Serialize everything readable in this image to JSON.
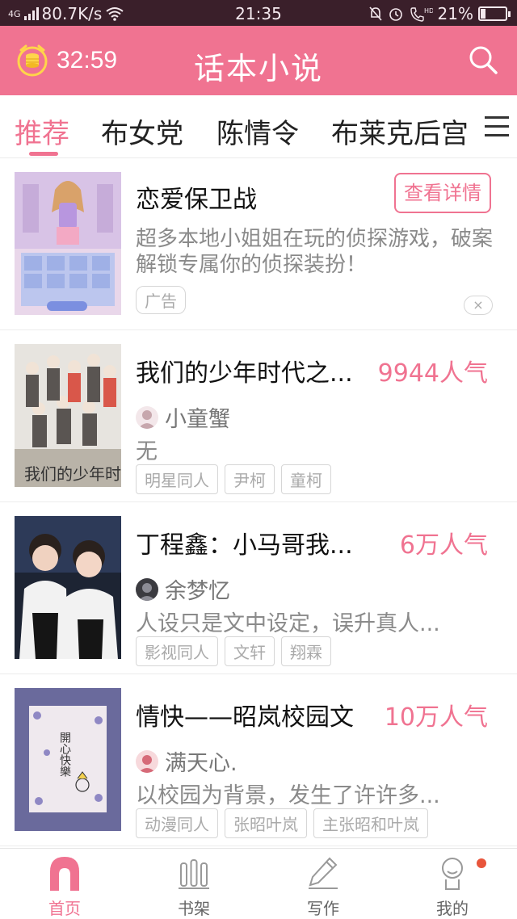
{
  "status_bar": {
    "network": "4G",
    "speed": "80.7K/s",
    "time": "21:35",
    "hd": "HD",
    "battery": "21%",
    "battery_level": 0.21
  },
  "header": {
    "timer": "32:59",
    "title": "话本小说",
    "icons": [
      "coin-clock-icon",
      "search-icon"
    ]
  },
  "tabs": {
    "items": [
      {
        "label": "推荐",
        "active": true
      },
      {
        "label": "布女党",
        "active": false
      },
      {
        "label": "陈情令",
        "active": false
      },
      {
        "label": "布莱克后宫",
        "active": false
      }
    ],
    "menu_icon": "menu-icon"
  },
  "ad": {
    "title": "恋爱保卫战",
    "button": "查看详情",
    "description": "超多本地小姐姐在玩的侦探游戏，破案解锁专属你的侦探装扮！",
    "label": "广告",
    "close": "×"
  },
  "stories": [
    {
      "title": "我们的少年时代之...",
      "popularity": "9944人气",
      "author": "小童蟹",
      "description": "无",
      "tags": [
        "明星同人",
        "尹柯",
        "童柯"
      ],
      "cover_text": "我们的少年时代"
    },
    {
      "title": "丁程鑫：小马哥我...",
      "popularity": "6万人气",
      "author": "余梦忆",
      "description": "人设只是文中设定，误升真人...",
      "tags": [
        "影视同人",
        "文轩",
        "翔霖"
      ],
      "cover_text": ""
    },
    {
      "title": "情快——昭岚校园文",
      "popularity": "10万人气",
      "author": "满天心.",
      "description": "以校园为背景，发生了许许多...",
      "tags": [
        "动漫同人",
        "张昭叶岚",
        "主张昭和叶岚"
      ],
      "cover_text": "開心快樂"
    }
  ],
  "bottom_nav": [
    {
      "label": "首页",
      "icon": "home-icon",
      "active": true
    },
    {
      "label": "书架",
      "icon": "bookshelf-icon",
      "active": false
    },
    {
      "label": "写作",
      "icon": "pen-icon",
      "active": false
    },
    {
      "label": "我的",
      "icon": "profile-icon",
      "active": false
    }
  ],
  "colors": {
    "accent": "#f07391",
    "status_bar": "#3a1f2a",
    "notification_dot": "#e8553b"
  }
}
